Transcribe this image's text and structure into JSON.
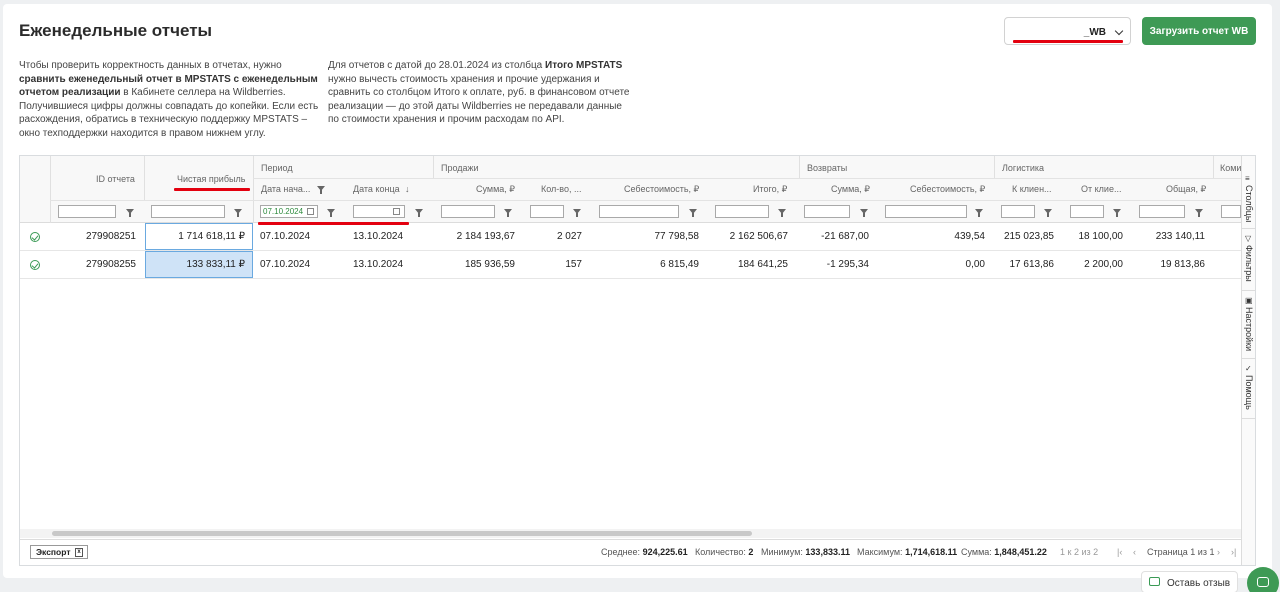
{
  "page_title": "Еженедельные отчеты",
  "description_left": {
    "part1": "Чтобы проверить корректность данных в отчетах, нужно ",
    "bold": "сравнить еженедельный отчет в MPSTATS с еженедельным отчетом реализации",
    "part2": " в Кабинете селлера на Wildberries. Получившиеся цифры должны совпадать до копейки. Если есть расхождения, обратись в техническую поддержку MPSTATS – окно техподдержки находится в правом нижнем углу."
  },
  "description_right": {
    "part1": "Для отчетов с датой до 28.01.2024 из столбца ",
    "bold": "Итого MPSTATS",
    "part2": " нужно вычесть стоимость хранения и прочие удержания и сравнить со столбцом Итого к оплате, руб. в финансовом отчете реализации — до этой даты Wildberries не передавали данные по стоимости хранения и прочим расходам по API."
  },
  "account_select": {
    "value": "_WB"
  },
  "upload_button": "Загрузить отчет WB",
  "groups": {
    "period": "Период",
    "sales": "Продажи",
    "returns": "Возвраты",
    "logistics": "Логистика",
    "commission": "Коми"
  },
  "columns": {
    "id": "ID отчета",
    "profit": "Чистая прибыль",
    "date_start": "Дата нача...",
    "date_end": "Дата конца",
    "sales_sum": "Сумма, ₽",
    "sales_qty": "Кол-во, ...",
    "sales_cost": "Себестоимость, ₽",
    "sales_total": "Итого, ₽",
    "ret_sum": "Сумма, ₽",
    "ret_cost": "Себестоимость, ₽",
    "log_to": "К клиен...",
    "log_from": "От клие...",
    "log_total": "Общая, ₽"
  },
  "filter": {
    "date_start_value": "07.10.2024"
  },
  "rows": [
    {
      "id": "279908251",
      "profit": "1 714 618,11 ₽",
      "date_start": "07.10.2024",
      "date_end": "13.10.2024",
      "sales_sum": "2 184 193,67",
      "sales_qty": "2 027",
      "sales_cost": "77 798,58",
      "sales_total": "2 162 506,67",
      "ret_sum": "-21 687,00",
      "ret_cost": "439,54",
      "log_to": "215 023,85",
      "log_from": "18 100,00",
      "log_total": "233 140,11"
    },
    {
      "id": "279908255",
      "profit": "133 833,11 ₽",
      "date_start": "07.10.2024",
      "date_end": "13.10.2024",
      "sales_sum": "185 936,59",
      "sales_qty": "157",
      "sales_cost": "6 815,49",
      "sales_total": "184 641,25",
      "ret_sum": "-1 295,34",
      "ret_cost": "0,00",
      "log_to": "17 613,86",
      "log_from": "2 200,00",
      "log_total": "19 813,86"
    }
  ],
  "footer": {
    "export": "Экспорт",
    "avg_label": "Среднее:",
    "avg": "924,225.61",
    "count_label": "Количество:",
    "count": "2",
    "min_label": "Минимум:",
    "min": "133,833.11",
    "max_label": "Максимум:",
    "max": "1,714,618.11",
    "sum_label": "Сумма:",
    "sum": "1,848,451.22",
    "range": "1 к 2 из 2",
    "page": "Страница 1 из 1"
  },
  "side_tabs": {
    "columns": "Столбцы",
    "filters": "Фильтры",
    "settings": "Настройки",
    "help": "Помощь"
  },
  "feedback": "Оставь отзыв",
  "accent_color": "#3e9a55",
  "highlight_color": "#e3000f"
}
